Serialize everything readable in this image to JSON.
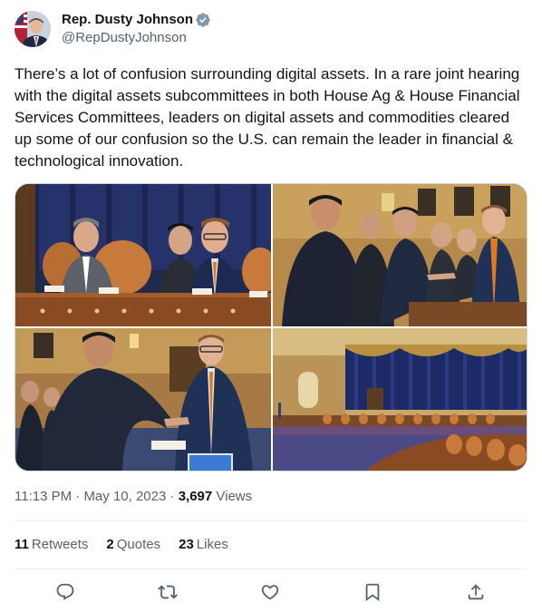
{
  "author": {
    "display_name": "Rep. Dusty Johnson",
    "handle": "@RepDustyJohnson",
    "verified": true
  },
  "tweet": {
    "text": "There’s a lot of confusion surrounding digital assets. In a rare joint hearing with the digital assets subcommittees in both House Ag & House Financial Services Committees, leaders on digital assets and commodities cleared up some of our confusion so the U.S. can remain the leader in financial & technological innovation."
  },
  "meta": {
    "time": "11:13 PM",
    "separator": " · ",
    "date": "May 10, 2023",
    "views_count": "3,697",
    "views_label": " Views"
  },
  "stats": {
    "retweets_count": "11",
    "retweets_label": "Retweets",
    "quotes_count": "2",
    "quotes_label": "Quotes",
    "likes_count": "23",
    "likes_label": "Likes"
  },
  "actions": [
    "reply-icon",
    "retweet-icon",
    "like-icon",
    "bookmark-icon",
    "share-icon"
  ],
  "colors": {
    "text_primary": "#0f1419",
    "text_secondary": "#536471",
    "verified_blue": "#1d9bf0",
    "divider": "#eff3f4"
  }
}
